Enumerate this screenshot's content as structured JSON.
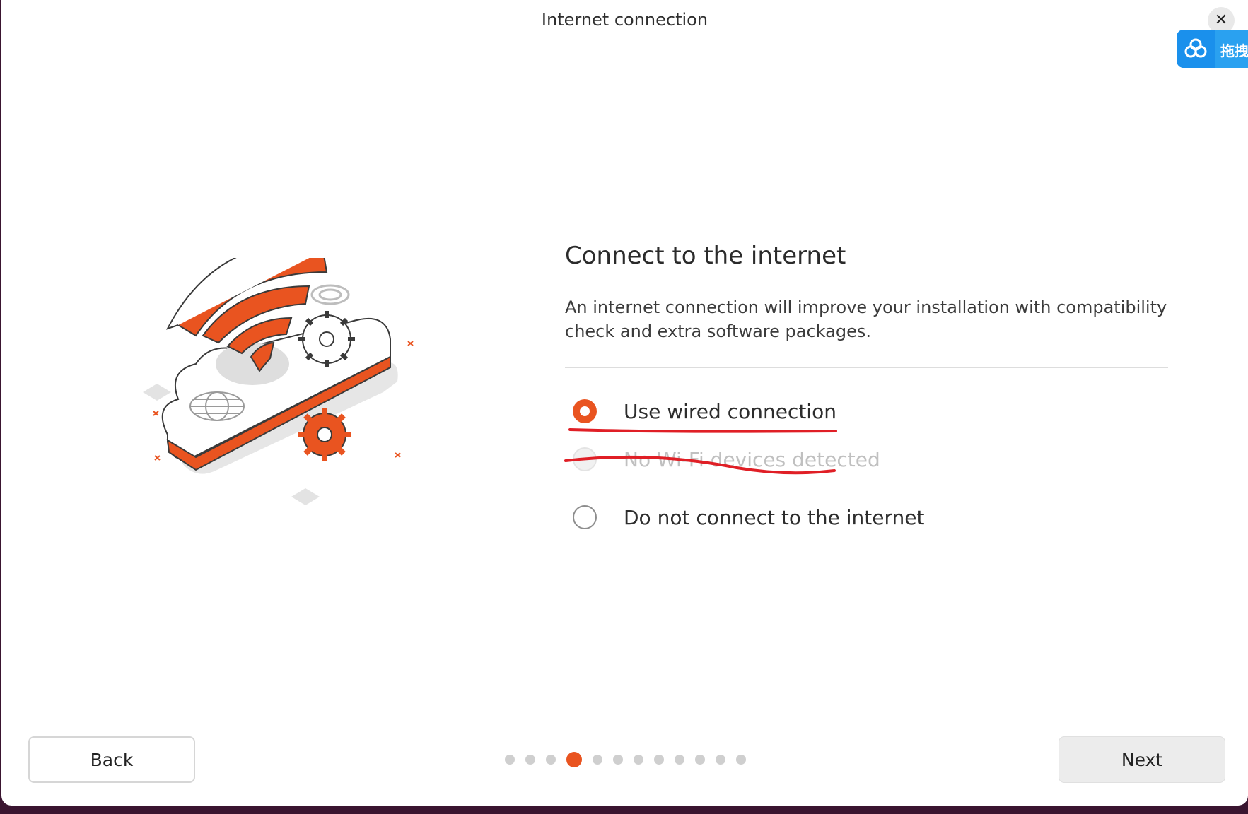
{
  "window": {
    "title": "Internet connection",
    "close_icon": "close-icon"
  },
  "floating_widget": {
    "icon": "cloud-link-icon",
    "label": "拖拽"
  },
  "content": {
    "heading": "Connect to the internet",
    "description": "An internet connection will improve your installation with compatibility check and extra software packages."
  },
  "options": [
    {
      "label": "Use wired connection",
      "selected": true,
      "disabled": false
    },
    {
      "label": "No Wi-Fi devices detected",
      "selected": false,
      "disabled": true
    },
    {
      "label": "Do not connect to the internet",
      "selected": false,
      "disabled": false
    }
  ],
  "footer": {
    "back_label": "Back",
    "next_label": "Next",
    "progress": {
      "total_steps": 12,
      "current_step": 4
    }
  },
  "colors": {
    "accent": "#e95420",
    "annotation": "#e01f26",
    "widget": "#1a90ec"
  }
}
